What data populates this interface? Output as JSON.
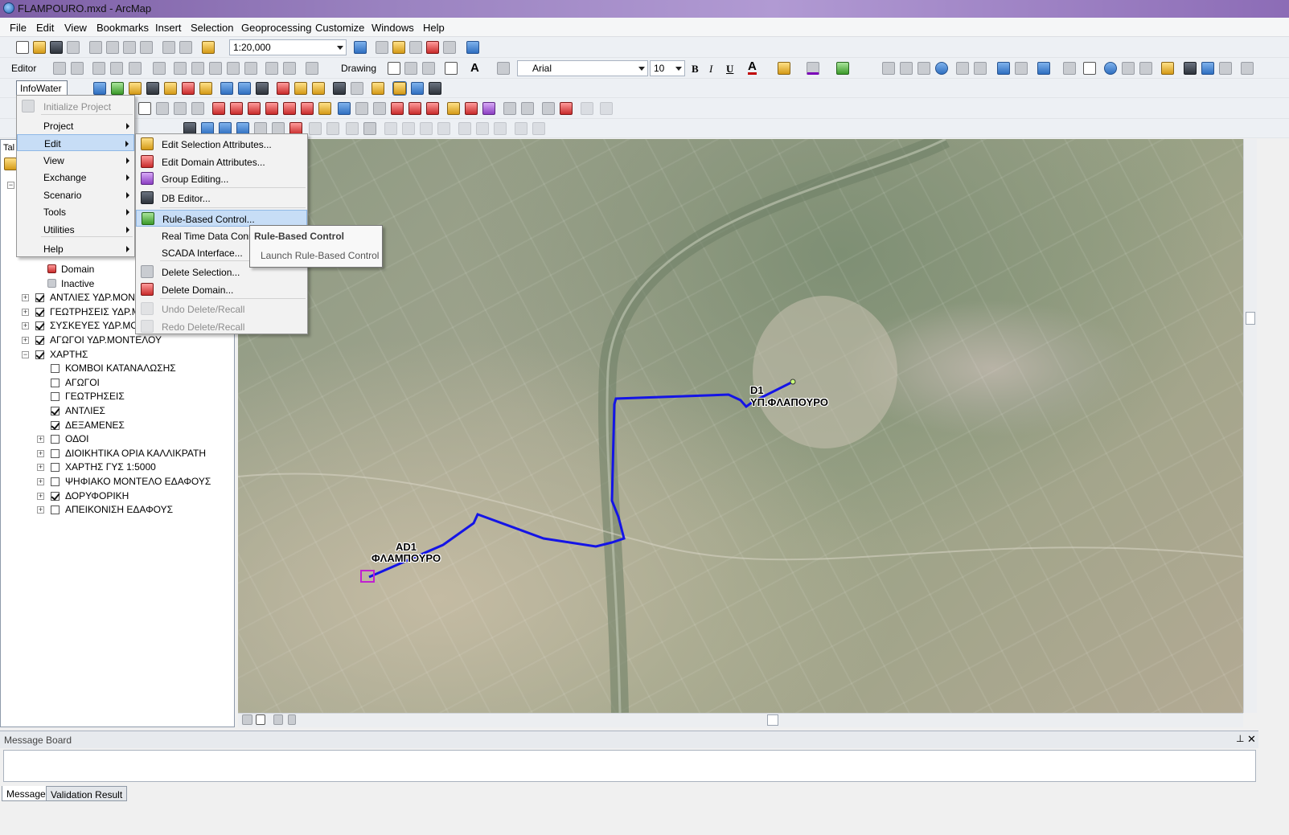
{
  "window": {
    "title": "FLAMPOURO.mxd - ArcMap"
  },
  "menubar": [
    "File",
    "Edit",
    "View",
    "Bookmarks",
    "Insert",
    "Selection",
    "Geoprocessing",
    "Customize",
    "Windows",
    "Help"
  ],
  "toolbar": {
    "scale": "1:20,000",
    "drawing_label": "Drawing",
    "font_name": "Arial",
    "font_size": "10",
    "bold": "B",
    "italic": "I",
    "underline": "U",
    "text_color_letter": "A",
    "text_tool_letter": "A",
    "editor_label": "Editor",
    "infowater_label": "InfoWater"
  },
  "infowater_menu": {
    "items": [
      {
        "label": "Initialize Project",
        "disabled": true
      },
      {
        "label": "Project"
      },
      {
        "label": "Edit",
        "highlighted": true
      },
      {
        "label": "View"
      },
      {
        "label": "Exchange"
      },
      {
        "label": "Scenario"
      },
      {
        "label": "Tools"
      },
      {
        "label": "Utilities"
      },
      {
        "label": "Help"
      }
    ]
  },
  "edit_submenu": {
    "items": [
      {
        "label": "Edit Selection Attributes..."
      },
      {
        "label": "Edit Domain Attributes..."
      },
      {
        "label": "Group Editing..."
      },
      {
        "label": "DB Editor..."
      },
      {
        "label": "Rule-Based Control...",
        "highlighted": true
      },
      {
        "label": "Real Time Data Conn"
      },
      {
        "label": "SCADA Interface..."
      },
      {
        "label": "Delete Selection..."
      },
      {
        "label": "Delete Domain..."
      },
      {
        "label": "Undo Delete/Recall",
        "disabled": true
      },
      {
        "label": "Redo Delete/Recall",
        "disabled": true
      }
    ]
  },
  "tooltip": {
    "title": "Rule-Based Control",
    "body": "Launch Rule-Based Control"
  },
  "toc": {
    "tab_fragment": "Tal",
    "items": [
      {
        "label": "Domain",
        "indent": 3,
        "checkbox": null
      },
      {
        "label": "Inactive",
        "indent": 3,
        "checkbox": null
      },
      {
        "label": "ΑΝΤΛΙΕΣ ΥΔΡ.ΜΟΝΤ",
        "indent": 1,
        "checkbox": true,
        "expander": "+"
      },
      {
        "label": "ΓΕΩΤΡΗΣΕΙΣ ΥΔΡ.ΜΟ",
        "indent": 1,
        "checkbox": true,
        "expander": "+"
      },
      {
        "label": "ΣΥΣΚΕΥΕΣ ΥΔΡ.ΜΟΝ",
        "indent": 1,
        "checkbox": true,
        "expander": "+"
      },
      {
        "label": "ΑΓΩΓΟΙ ΥΔΡ.ΜΟΝΤΕΛΟΥ",
        "indent": 1,
        "checkbox": true,
        "expander": "+"
      },
      {
        "label": "ΧΑΡΤΗΣ",
        "indent": 1,
        "checkbox": true,
        "expander": "−"
      },
      {
        "label": "ΚΟΜΒΟΙ ΚΑΤΑΝΑΛΩΣΗΣ",
        "indent": 2,
        "checkbox": false
      },
      {
        "label": "ΑΓΩΓΟΙ",
        "indent": 2,
        "checkbox": false
      },
      {
        "label": "ΓΕΩΤΡΗΣΕΙΣ",
        "indent": 2,
        "checkbox": false
      },
      {
        "label": "ΑΝΤΛΙΕΣ",
        "indent": 2,
        "checkbox": true
      },
      {
        "label": "ΔΕΞΑΜΕΝΕΣ",
        "indent": 2,
        "checkbox": true
      },
      {
        "label": "ΟΔΟΙ",
        "indent": 2,
        "checkbox": false,
        "expander": "+"
      },
      {
        "label": "ΔΙΟΙΚΗΤΙΚΑ ΟΡΙΑ ΚΑΛΛΙΚΡΑΤΗ",
        "indent": 2,
        "checkbox": false,
        "expander": "+"
      },
      {
        "label": "ΧΑΡΤΗΣ ΓΥΣ 1:5000",
        "indent": 2,
        "checkbox": false,
        "expander": "+"
      },
      {
        "label": "ΨΗΦΙΑΚΟ ΜΟΝΤΕΛΟ ΕΔΑΦΟΥΣ",
        "indent": 2,
        "checkbox": false,
        "expander": "+"
      },
      {
        "label": "ΔΟΡΥΦΟΡΙΚΗ",
        "indent": 2,
        "checkbox": true,
        "expander": "+"
      },
      {
        "label": "ΑΠΕΙΚΟΝΙΣΗ ΕΔΑΦΟΥΣ",
        "indent": 2,
        "checkbox": false,
        "expander": "+"
      }
    ]
  },
  "map": {
    "labels": [
      {
        "id": "d1-code",
        "text": "D1"
      },
      {
        "id": "d1-name",
        "text": "ΥΠ.ΦΛΑΠΟΥΡΟ"
      },
      {
        "id": "ad1-code",
        "text": "AD1"
      },
      {
        "id": "ad1-name",
        "text": "ΦΛΑΜΠΟΥΡΟ"
      }
    ],
    "pipe_color": "#1414e6",
    "marker_color": "#c020d0"
  },
  "message_board": {
    "title": "Message Board",
    "tabs": [
      "Message",
      "Validation Result"
    ]
  },
  "colors": {
    "titlebar": "#9a82c0",
    "menu_highlight": "#c7ddf6"
  }
}
